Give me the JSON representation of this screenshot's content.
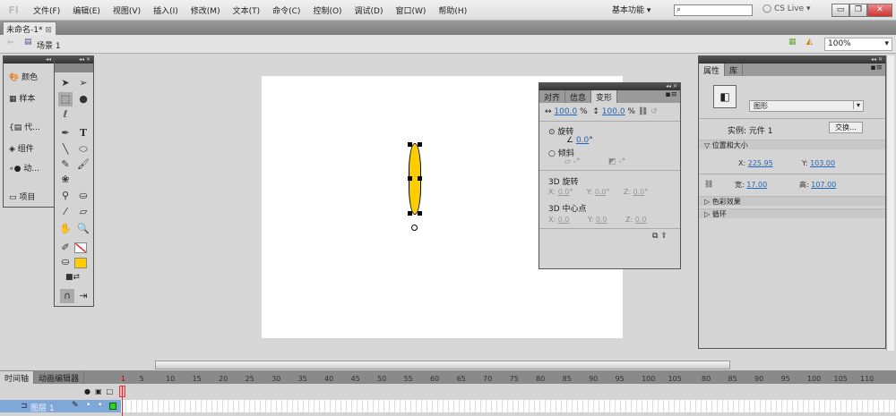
{
  "app": {
    "logo": "Fl"
  },
  "menu": [
    "文件(F)",
    "编辑(E)",
    "视图(V)",
    "插入(I)",
    "修改(M)",
    "文本(T)",
    "命令(C)",
    "控制(O)",
    "调试(D)",
    "窗口(W)",
    "帮助(H)"
  ],
  "workspace": "基本功能 ▾",
  "search": {
    "placeholder": "",
    "icon": "search-icon"
  },
  "cslive": "CS Live",
  "document_tab": "未命名-1*",
  "scene": "场景 1",
  "zoom": "100%",
  "left_panel": {
    "items": [
      "颜色",
      "样本",
      "代...",
      "组件",
      "动...",
      "项目"
    ]
  },
  "transform_panel": {
    "tabs": [
      "对齐",
      "信息",
      "变形"
    ],
    "scale_w": "100.0",
    "scale_h": "100.0",
    "pct": "%",
    "rotate_label": "旋转",
    "rotate_value": "0.0",
    "deg": "°",
    "skew_label": "倾斜",
    "skew_h": "-",
    "skew_v": "-",
    "rot3d_label": "3D 旋转",
    "rot3d": {
      "x": "0.0",
      "y": "0.0",
      "z": "0.0"
    },
    "center3d_label": "3D 中心点",
    "center3d": {
      "x": "0.0",
      "y": "0.0",
      "z": "0.0"
    },
    "axis": [
      "X:",
      "Y:",
      "Z:"
    ]
  },
  "properties_panel": {
    "tabs": [
      "属性",
      "库"
    ],
    "type": "图形",
    "instance_label": "实例:",
    "instance_name": "元件 1",
    "swap_button": "交换...",
    "section_position": "位置和大小",
    "x_label": "X:",
    "x": "225.95",
    "y_label": "Y:",
    "y": "103.00",
    "w_label": "宽:",
    "w": "17.00",
    "h_label": "高:",
    "h": "107.00",
    "section_color": "色彩效果",
    "section_loop": "循环"
  },
  "timeline": {
    "tabs": [
      "时间轴",
      "动画编辑器"
    ],
    "layer": "图层 1",
    "frames": [
      "1",
      "5",
      "10",
      "15",
      "20",
      "25",
      "30",
      "35",
      "40",
      "45",
      "50",
      "55",
      "60",
      "65",
      "70",
      "75",
      "80",
      "85",
      "90",
      "95",
      "100",
      "105"
    ],
    "frames2": [
      "80",
      "85",
      "90",
      "95",
      "100",
      "105",
      "110"
    ]
  },
  "colors": {
    "fill": "#ffcc00",
    "stroke": "none",
    "accent": "#2266bb"
  }
}
